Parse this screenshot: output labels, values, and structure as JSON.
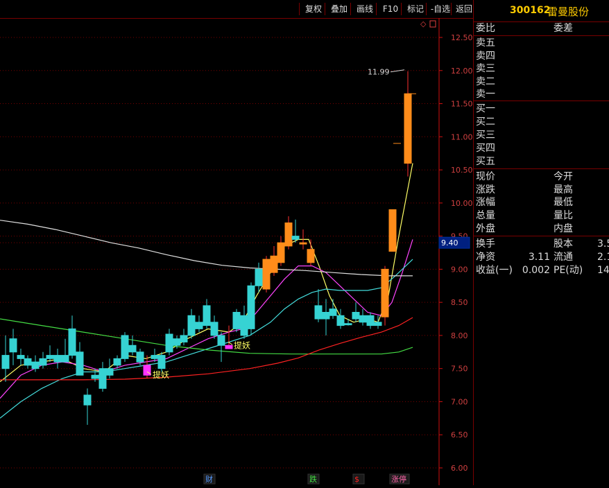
{
  "toolbar": {
    "buttons": [
      "复权",
      "叠加",
      "画线",
      "F10",
      "标记",
      "-自选",
      "返回"
    ]
  },
  "stock": {
    "code": "300162",
    "name": "雷曼股份"
  },
  "order_book": {
    "header": [
      "委比",
      "委差"
    ],
    "sells": [
      "卖五",
      "卖四",
      "卖三",
      "卖二",
      "卖一"
    ],
    "buys": [
      "买一",
      "买二",
      "买三",
      "买四",
      "买五"
    ]
  },
  "quote": {
    "rows": [
      {
        "l1": "现价",
        "l2": "今开"
      },
      {
        "l1": "涨跌",
        "l2": "最高"
      },
      {
        "l1": "涨幅",
        "l2": "最低"
      },
      {
        "l1": "总量",
        "l2": "量比"
      },
      {
        "l1": "外盘",
        "l2": "内盘"
      }
    ]
  },
  "fundamentals": {
    "rows": [
      {
        "l1": "换手",
        "v1": "",
        "l2": "股本",
        "v2": "3.5"
      },
      {
        "l1": "净资",
        "v1": "3.11",
        "l2": "流通",
        "v2": "2.1"
      },
      {
        "l1": "收益(一)",
        "v1": "0.002",
        "l2": "PE(动)",
        "v2": "14"
      }
    ]
  },
  "chart_data": {
    "type": "candlestick",
    "y_ticks": [
      "12.50",
      "12.00",
      "11.50",
      "11.00",
      "10.50",
      "10.00",
      "9.50",
      "9.00",
      "8.50",
      "8.00",
      "7.50",
      "7.00",
      "6.50",
      "6.00"
    ],
    "ylim": [
      5.95,
      12.7
    ],
    "current_price_label": "9.40",
    "max_annotation": "11.99",
    "colors": {
      "up": "#ff8c1a",
      "down": "#36d3d3",
      "grid": "#7a0000",
      "axis": "#d01010",
      "ma5": "#ffff66",
      "ma10": "#ff44ff",
      "ma20": "#44dddd",
      "ma60": "#44dd44",
      "ma120": "#ff2222",
      "ma250": "#e0e0e0"
    },
    "candles": [
      {
        "x": 3,
        "o": 7.5,
        "h": 8.0,
        "l": 7.3,
        "c": 7.7,
        "up": false
      },
      {
        "x": 14,
        "o": 7.75,
        "h": 8.1,
        "l": 7.55,
        "c": 7.95,
        "up": false
      },
      {
        "x": 25,
        "o": 7.7,
        "h": 7.8,
        "l": 7.55,
        "c": 7.65,
        "up": false
      },
      {
        "x": 35,
        "o": 7.65,
        "h": 7.7,
        "l": 7.5,
        "c": 7.55,
        "up": false
      },
      {
        "x": 46,
        "o": 7.6,
        "h": 7.7,
        "l": 7.45,
        "c": 7.5,
        "up": false
      },
      {
        "x": 57,
        "o": 7.55,
        "h": 7.75,
        "l": 7.5,
        "c": 7.65,
        "up": false
      },
      {
        "x": 67,
        "o": 7.7,
        "h": 7.85,
        "l": 7.6,
        "c": 7.65,
        "up": false
      },
      {
        "x": 78,
        "o": 7.6,
        "h": 7.8,
        "l": 7.5,
        "c": 7.7,
        "up": false
      },
      {
        "x": 89,
        "o": 7.7,
        "h": 7.95,
        "l": 7.6,
        "c": 7.6,
        "up": false
      },
      {
        "x": 99,
        "o": 8.1,
        "h": 8.3,
        "l": 7.65,
        "c": 7.7,
        "up": false
      },
      {
        "x": 110,
        "o": 7.75,
        "h": 7.9,
        "l": 7.4,
        "c": 7.4,
        "up": false
      },
      {
        "x": 121,
        "o": 7.1,
        "h": 7.2,
        "l": 6.65,
        "c": 6.95,
        "up": false
      },
      {
        "x": 132,
        "o": 7.4,
        "h": 7.5,
        "l": 7.3,
        "c": 7.35,
        "up": false
      },
      {
        "x": 143,
        "o": 7.5,
        "h": 7.6,
        "l": 7.15,
        "c": 7.2,
        "up": false
      },
      {
        "x": 153,
        "o": 7.5,
        "h": 7.65,
        "l": 7.35,
        "c": 7.4,
        "up": false
      },
      {
        "x": 164,
        "o": 7.55,
        "h": 7.7,
        "l": 7.5,
        "c": 7.65,
        "up": false
      },
      {
        "x": 175,
        "o": 8.0,
        "h": 8.05,
        "l": 7.6,
        "c": 7.65,
        "up": false
      },
      {
        "x": 186,
        "o": 7.85,
        "h": 8.0,
        "l": 7.7,
        "c": 7.75,
        "up": false
      },
      {
        "x": 197,
        "o": 7.75,
        "h": 7.8,
        "l": 7.55,
        "c": 7.6,
        "up": false
      },
      {
        "x": 207,
        "o": 7.55,
        "h": 7.7,
        "l": 7.35,
        "c": 7.4,
        "up": true,
        "magenta": true
      },
      {
        "x": 218,
        "o": 7.7,
        "h": 7.8,
        "l": 7.6,
        "c": 7.65,
        "up": false
      },
      {
        "x": 228,
        "o": 7.7,
        "h": 7.75,
        "l": 7.45,
        "c": 7.5,
        "up": false
      },
      {
        "x": 239,
        "o": 8.02,
        "h": 8.1,
        "l": 7.7,
        "c": 7.75,
        "up": false
      },
      {
        "x": 250,
        "o": 7.95,
        "h": 8.0,
        "l": 7.8,
        "c": 7.85,
        "up": false
      },
      {
        "x": 260,
        "o": 8.0,
        "h": 8.1,
        "l": 7.85,
        "c": 7.9,
        "up": false
      },
      {
        "x": 271,
        "o": 8.3,
        "h": 8.4,
        "l": 7.95,
        "c": 8.0,
        "up": false
      },
      {
        "x": 282,
        "o": 8.2,
        "h": 8.3,
        "l": 8.05,
        "c": 8.1,
        "up": false
      },
      {
        "x": 293,
        "o": 8.45,
        "h": 8.55,
        "l": 8.1,
        "c": 8.15,
        "up": false
      },
      {
        "x": 304,
        "o": 8.2,
        "h": 8.3,
        "l": 7.95,
        "c": 8.0,
        "up": false
      },
      {
        "x": 314,
        "o": 8.0,
        "h": 8.05,
        "l": 7.6,
        "c": 7.85,
        "up": false
      },
      {
        "x": 325,
        "o": 7.85,
        "h": 8.15,
        "l": 7.8,
        "c": 7.8,
        "up": true,
        "magenta": true
      },
      {
        "x": 336,
        "o": 8.35,
        "h": 8.4,
        "l": 8.05,
        "c": 8.1,
        "up": false
      },
      {
        "x": 347,
        "o": 8.3,
        "h": 8.45,
        "l": 7.95,
        "c": 8.0,
        "up": false
      },
      {
        "x": 357,
        "o": 8.75,
        "h": 8.8,
        "l": 8.0,
        "c": 8.1,
        "up": false
      },
      {
        "x": 368,
        "o": 9.0,
        "h": 9.1,
        "l": 8.65,
        "c": 8.75,
        "up": false
      },
      {
        "x": 379,
        "o": 8.7,
        "h": 9.2,
        "l": 8.65,
        "c": 9.15,
        "up": true
      },
      {
        "x": 390,
        "o": 8.95,
        "h": 9.35,
        "l": 8.9,
        "c": 9.2,
        "up": true
      },
      {
        "x": 400,
        "o": 9.1,
        "h": 9.5,
        "l": 9.05,
        "c": 9.4,
        "up": true
      },
      {
        "x": 411,
        "o": 9.35,
        "h": 9.8,
        "l": 9.3,
        "c": 9.7,
        "up": true
      },
      {
        "x": 421,
        "o": 9.5,
        "h": 9.75,
        "l": 9.4,
        "c": 9.45,
        "up": false
      },
      {
        "x": 432,
        "o": 9.4,
        "h": 9.6,
        "l": 9.3,
        "c": 9.38,
        "up": true
      },
      {
        "x": 443,
        "o": 9.3,
        "h": 9.45,
        "l": 9.05,
        "c": 9.1,
        "up": true
      },
      {
        "x": 454,
        "o": 8.45,
        "h": 8.7,
        "l": 8.2,
        "c": 8.25,
        "up": false
      },
      {
        "x": 465,
        "o": 8.35,
        "h": 8.55,
        "l": 8.0,
        "c": 8.25,
        "up": false
      },
      {
        "x": 475,
        "o": 8.4,
        "h": 8.55,
        "l": 8.25,
        "c": 8.3,
        "up": false
      },
      {
        "x": 486,
        "o": 8.3,
        "h": 8.4,
        "l": 8.1,
        "c": 8.15,
        "up": false
      },
      {
        "x": 497,
        "o": 8.18,
        "h": 8.25,
        "l": 8.15,
        "c": 8.16,
        "up": false
      },
      {
        "x": 508,
        "o": 8.35,
        "h": 8.5,
        "l": 8.2,
        "c": 8.25,
        "up": false
      },
      {
        "x": 518,
        "o": 8.3,
        "h": 8.4,
        "l": 8.15,
        "c": 8.2,
        "up": false
      },
      {
        "x": 529,
        "o": 8.3,
        "h": 8.35,
        "l": 8.1,
        "c": 8.15,
        "up": false
      },
      {
        "x": 540,
        "o": 8.2,
        "h": 8.3,
        "l": 8.1,
        "c": 8.15,
        "up": false
      },
      {
        "x": 550,
        "o": 8.28,
        "h": 9.05,
        "l": 8.15,
        "c": 9.0,
        "up": true
      },
      {
        "x": 561,
        "o": 9.27,
        "h": 9.9,
        "l": 9.27,
        "c": 9.9,
        "up": true
      },
      {
        "x": 583,
        "o": 10.6,
        "h": 11.99,
        "l": 10.4,
        "c": 11.65,
        "up": true
      }
    ],
    "ma_lines": [
      {
        "name": "ma5",
        "points": [
          [
            0,
            7.3
          ],
          [
            30,
            7.55
          ],
          [
            60,
            7.6
          ],
          [
            90,
            7.65
          ],
          [
            120,
            7.5
          ],
          [
            150,
            7.45
          ],
          [
            180,
            7.7
          ],
          [
            210,
            7.65
          ],
          [
            240,
            7.75
          ],
          [
            270,
            7.95
          ],
          [
            300,
            8.1
          ],
          [
            330,
            8.05
          ],
          [
            350,
            8.2
          ],
          [
            370,
            8.6
          ],
          [
            390,
            8.95
          ],
          [
            410,
            9.35
          ],
          [
            430,
            9.45
          ],
          [
            445,
            9.45
          ],
          [
            460,
            9.05
          ],
          [
            475,
            8.6
          ],
          [
            490,
            8.3
          ],
          [
            510,
            8.2
          ],
          [
            530,
            8.25
          ],
          [
            545,
            8.2
          ],
          [
            560,
            8.6
          ],
          [
            575,
            9.5
          ],
          [
            595,
            10.6
          ]
        ]
      },
      {
        "name": "ma10",
        "points": [
          [
            0,
            7.05
          ],
          [
            30,
            7.4
          ],
          [
            60,
            7.55
          ],
          [
            90,
            7.6
          ],
          [
            120,
            7.55
          ],
          [
            150,
            7.45
          ],
          [
            180,
            7.55
          ],
          [
            210,
            7.6
          ],
          [
            240,
            7.65
          ],
          [
            270,
            7.8
          ],
          [
            300,
            7.95
          ],
          [
            330,
            8.05
          ],
          [
            350,
            8.1
          ],
          [
            370,
            8.35
          ],
          [
            390,
            8.6
          ],
          [
            410,
            8.85
          ],
          [
            430,
            9.05
          ],
          [
            450,
            9.05
          ],
          [
            470,
            8.95
          ],
          [
            490,
            8.75
          ],
          [
            510,
            8.55
          ],
          [
            530,
            8.35
          ],
          [
            550,
            8.3
          ],
          [
            565,
            8.5
          ],
          [
            580,
            8.95
          ],
          [
            595,
            9.45
          ]
        ]
      },
      {
        "name": "ma20",
        "points": [
          [
            0,
            6.75
          ],
          [
            30,
            7.0
          ],
          [
            60,
            7.2
          ],
          [
            90,
            7.35
          ],
          [
            120,
            7.45
          ],
          [
            150,
            7.45
          ],
          [
            180,
            7.5
          ],
          [
            210,
            7.55
          ],
          [
            240,
            7.6
          ],
          [
            270,
            7.7
          ],
          [
            300,
            7.8
          ],
          [
            330,
            7.9
          ],
          [
            360,
            8.0
          ],
          [
            390,
            8.2
          ],
          [
            410,
            8.4
          ],
          [
            430,
            8.55
          ],
          [
            450,
            8.65
          ],
          [
            470,
            8.7
          ],
          [
            490,
            8.68
          ],
          [
            510,
            8.68
          ],
          [
            530,
            8.68
          ],
          [
            550,
            8.72
          ],
          [
            570,
            8.9
          ],
          [
            595,
            9.15
          ]
        ]
      },
      {
        "name": "ma60",
        "points": [
          [
            0,
            8.25
          ],
          [
            60,
            8.15
          ],
          [
            120,
            8.05
          ],
          [
            180,
            7.95
          ],
          [
            240,
            7.85
          ],
          [
            300,
            7.78
          ],
          [
            360,
            7.73
          ],
          [
            420,
            7.72
          ],
          [
            480,
            7.72
          ],
          [
            550,
            7.72
          ],
          [
            575,
            7.75
          ],
          [
            595,
            7.82
          ]
        ]
      },
      {
        "name": "ma120",
        "points": [
          [
            0,
            7.33
          ],
          [
            60,
            7.33
          ],
          [
            120,
            7.33
          ],
          [
            180,
            7.34
          ],
          [
            240,
            7.37
          ],
          [
            300,
            7.42
          ],
          [
            360,
            7.5
          ],
          [
            400,
            7.58
          ],
          [
            430,
            7.66
          ],
          [
            460,
            7.78
          ],
          [
            490,
            7.88
          ],
          [
            520,
            7.97
          ],
          [
            550,
            8.05
          ],
          [
            575,
            8.15
          ],
          [
            595,
            8.27
          ]
        ]
      },
      {
        "name": "ma250",
        "points": [
          [
            0,
            9.74
          ],
          [
            40,
            9.68
          ],
          [
            80,
            9.6
          ],
          [
            120,
            9.5
          ],
          [
            160,
            9.4
          ],
          [
            200,
            9.32
          ],
          [
            240,
            9.22
          ],
          [
            280,
            9.13
          ],
          [
            320,
            9.06
          ],
          [
            360,
            9.02
          ],
          [
            400,
            9.0
          ],
          [
            440,
            8.98
          ],
          [
            480,
            8.95
          ],
          [
            520,
            8.92
          ],
          [
            560,
            8.9
          ],
          [
            595,
            8.9
          ]
        ]
      }
    ],
    "annotations": [
      {
        "text": "提妖",
        "x": 220,
        "price": 7.4,
        "color": "#ffff66"
      },
      {
        "text": "提妖",
        "x": 337,
        "price": 7.85,
        "color": "#ffff66"
      }
    ],
    "bottom_marks": [
      {
        "text": "财",
        "x": 302,
        "color": "#5599ff"
      },
      {
        "text": "跌",
        "x": 452,
        "color": "#44dd44"
      },
      {
        "text": "$",
        "x": 517,
        "color": "#ff2222"
      },
      {
        "text": "涨停",
        "x": 576,
        "color": "#ff66aa"
      }
    ]
  }
}
